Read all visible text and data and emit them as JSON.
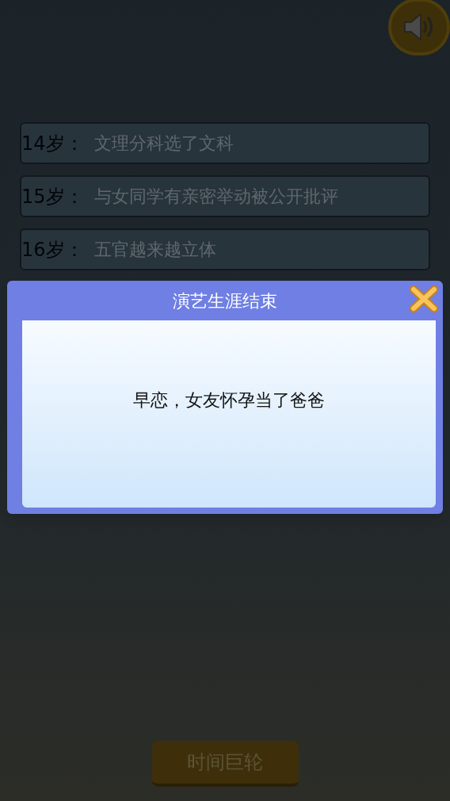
{
  "sound_button": {
    "on": true
  },
  "timeline": [
    {
      "age": "14岁：",
      "event": "文理分科选了文科"
    },
    {
      "age": "15岁：",
      "event": "与女同学有亲密举动被公开批评"
    },
    {
      "age": "16岁：",
      "event": "五官越来越立体"
    }
  ],
  "dialog": {
    "title": "演艺生涯结束",
    "message": "早恋，女友怀孕当了爸爸"
  },
  "bottom_button": "时间巨轮"
}
